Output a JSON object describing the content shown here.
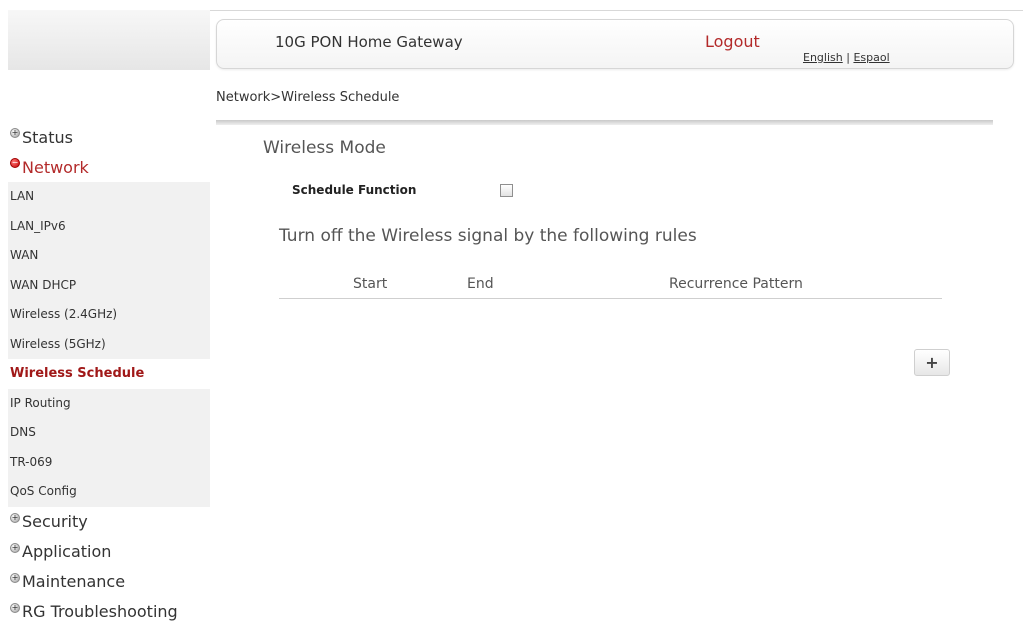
{
  "header": {
    "title": "10G PON Home Gateway",
    "logout_label": "Logout",
    "lang_english": "English",
    "lang_separator": " | ",
    "lang_spanish": "Espaol"
  },
  "breadcrumb": "Network>Wireless Schedule",
  "sidebar": {
    "status": "Status",
    "network": "Network",
    "network_items": [
      "LAN",
      "LAN_IPv6",
      "WAN",
      "WAN DHCP",
      "Wireless (2.4GHz)",
      "Wireless (5GHz)",
      "Wireless Schedule",
      "IP Routing",
      "DNS",
      "TR-069",
      "QoS Config"
    ],
    "active_item": "Wireless Schedule",
    "security": "Security",
    "application": "Application",
    "maintenance": "Maintenance",
    "troubleshooting": "RG Troubleshooting"
  },
  "main": {
    "section_title": "Wireless Mode",
    "schedule_function_label": "Schedule Function",
    "schedule_function_checked": false,
    "rules_text": "Turn off the Wireless signal by the following rules",
    "table_headers": {
      "start": "Start",
      "end": "End",
      "recurrence": "Recurrence Pattern"
    },
    "add_button": "+"
  },
  "icons": {
    "expand": "plus-bullet-icon",
    "collapse": "minus-bullet-icon"
  },
  "colors": {
    "accent_red": "#b32a2a",
    "active_item": "#a01818"
  }
}
